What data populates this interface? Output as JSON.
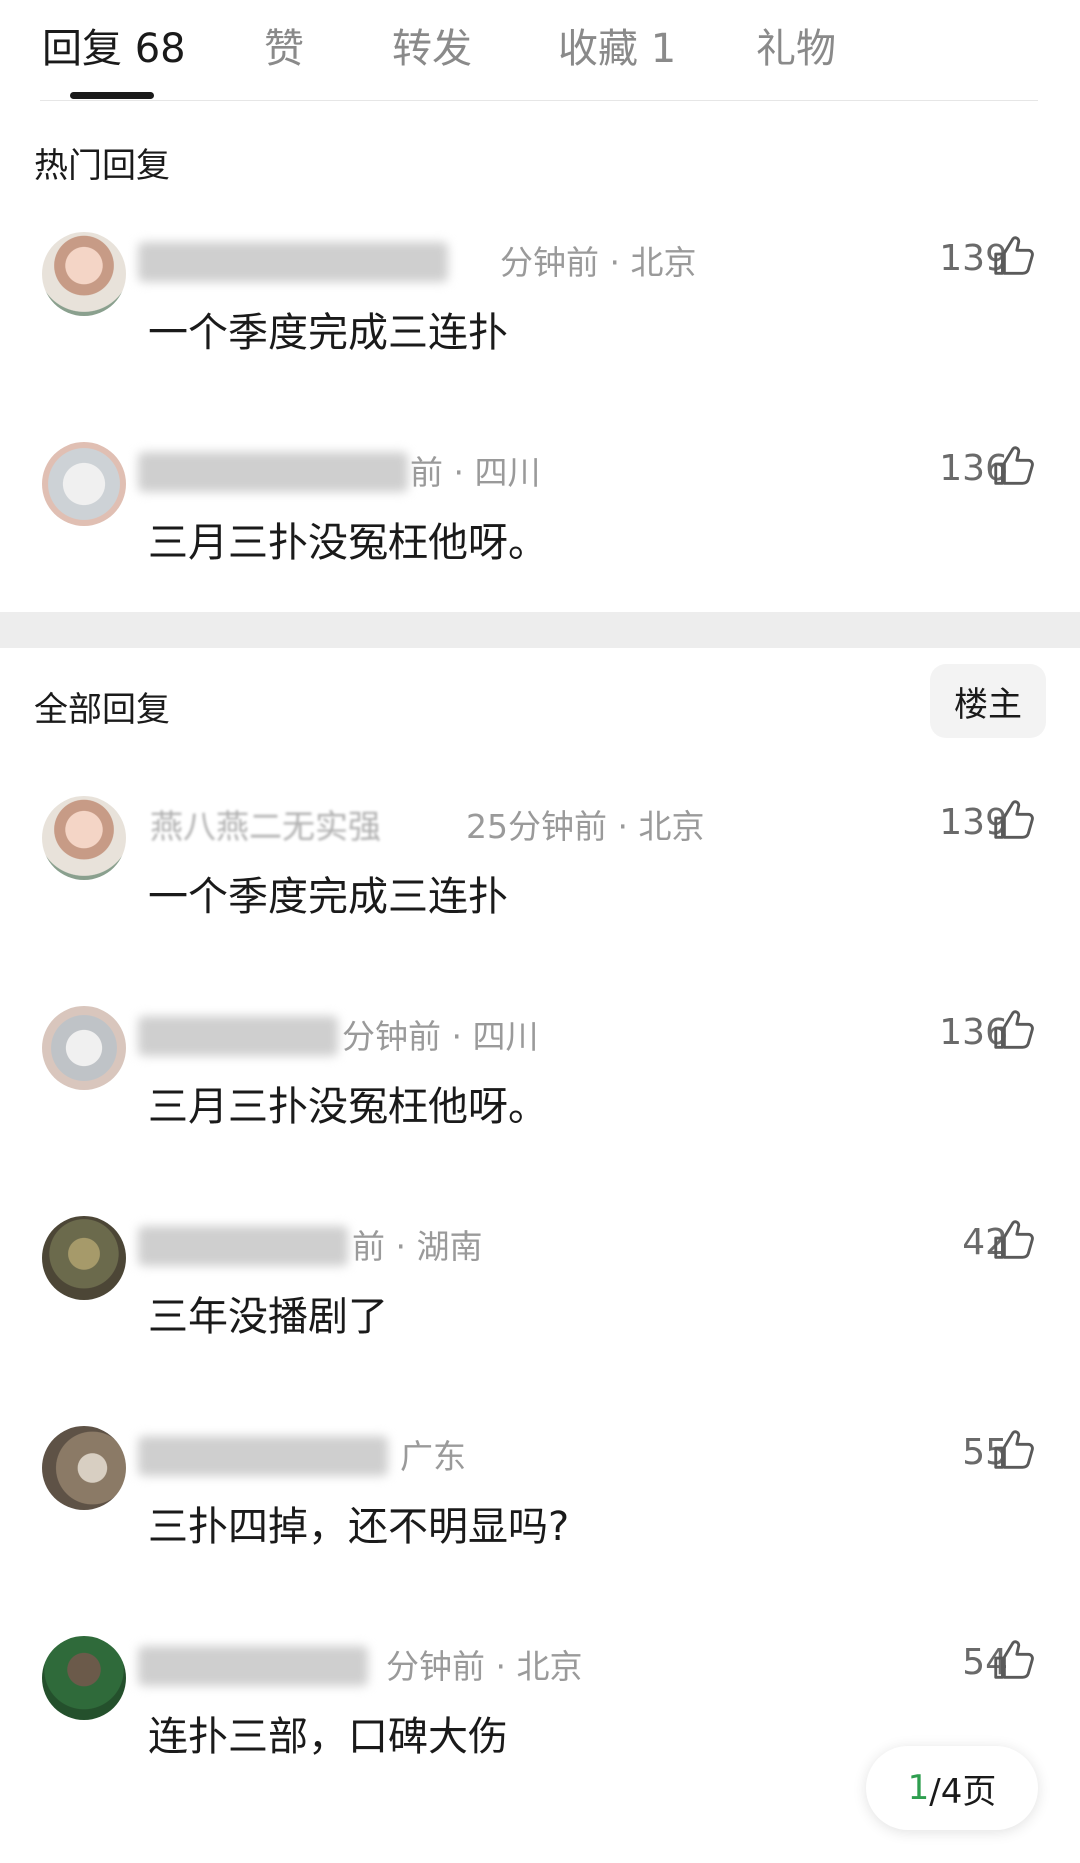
{
  "tabs": [
    {
      "label": "回复",
      "count": "68"
    },
    {
      "label": "赞",
      "count": ""
    },
    {
      "label": "转发",
      "count": ""
    },
    {
      "label": "收藏",
      "count": "1"
    },
    {
      "label": "礼物",
      "count": ""
    }
  ],
  "hot_section": {
    "title": "热门回复"
  },
  "all_section": {
    "title": "全部回复",
    "owner_button": "楼主"
  },
  "hot_comments": [
    {
      "meta": "分钟前 · 北京",
      "text": "一个季度完成三连扑",
      "likes": "139"
    },
    {
      "meta": "前 · 四川",
      "text": "三月三扑没冤枉他呀。",
      "likes": "136"
    }
  ],
  "all_comments": [
    {
      "username": "燕八燕二无实强",
      "meta": "25分钟前 · 北京",
      "text": "一个季度完成三连扑",
      "likes": "139"
    },
    {
      "meta": "分钟前 · 四川",
      "text": "三月三扑没冤枉他呀。",
      "likes": "136"
    },
    {
      "meta": "前 · 湖南",
      "text": "三年没播剧了",
      "likes": "42"
    },
    {
      "meta": "广东",
      "text": "三扑四掉，还不明显吗?",
      "likes": "55"
    },
    {
      "meta": "分钟前 · 北京",
      "text": "连扑三部，口碑大伤",
      "likes": "54"
    }
  ],
  "pager": {
    "current": "1",
    "total": "/4页"
  },
  "icons": {
    "like": "thumbs-up-icon"
  },
  "colors": {
    "accent_green": "#2e9e4f",
    "separator_band": "#ededed"
  }
}
